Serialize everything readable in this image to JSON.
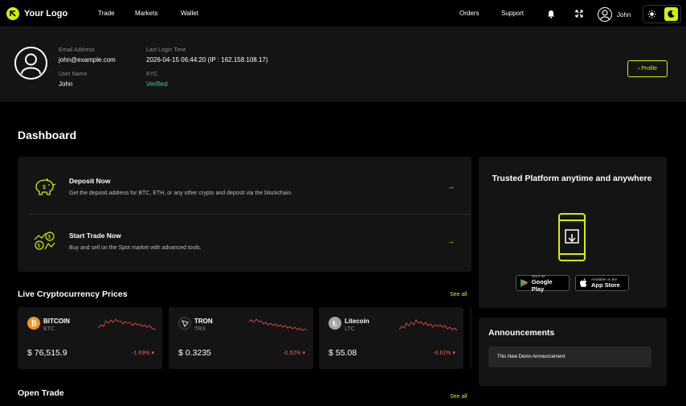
{
  "brand": {
    "name": "Your Logo",
    "accent": "#d4f000"
  },
  "nav": {
    "trade": "Trade",
    "markets": "Markets",
    "wallet": "Wallet",
    "orders": "Orders",
    "support": "Support"
  },
  "user": {
    "name": "John"
  },
  "profile": {
    "email_label": "Email Address",
    "email": "john@example.com",
    "username_label": "User Name",
    "username": "John",
    "login_label": "Last Login Time",
    "login": "2026-04-15 06:44:20 (IP : 162.158.108.17)",
    "kyc_label": "KYC",
    "kyc": "Verified",
    "profile_button": "› Profile"
  },
  "dashboard": {
    "title": "Dashboard",
    "actions": [
      {
        "title": "Deposit Now",
        "desc": "Get the deposit address for BTC, ETH, or any other crypto and deposit via the blockchain.",
        "arrow": "→"
      },
      {
        "title": "Start Trade Now",
        "desc": "Buy and sell on the Spot market with advanced tools.",
        "arrow": "→"
      }
    ]
  },
  "promo": {
    "title": "Trusted Platform anytime and anywhere",
    "google_small": "Get it on",
    "google_big": "Google Play",
    "apple_small": "Available on the",
    "apple_big": "App Store"
  },
  "prices": {
    "title": "Live Cryptocurrency Prices",
    "see_all": "See all",
    "coins": [
      {
        "name": "BITCOIN",
        "symbol": "BTC",
        "price": "$ 76,515.9",
        "change": "-1.69%",
        "color": "#f7931a"
      },
      {
        "name": "TRON",
        "symbol": "TRX",
        "price": "$ 0.3235",
        "change": "-0.52%",
        "color": "#1a1a1a"
      },
      {
        "name": "Litecoin",
        "symbol": "LTC",
        "price": "$ 55.08",
        "change": "-0.61%",
        "color": "#a6a6a6"
      }
    ]
  },
  "announcements": {
    "title": "Announcements",
    "items": [
      "This New Demo Announcement"
    ]
  },
  "open_trade": {
    "title": "Open Trade",
    "see_all": "See all"
  }
}
